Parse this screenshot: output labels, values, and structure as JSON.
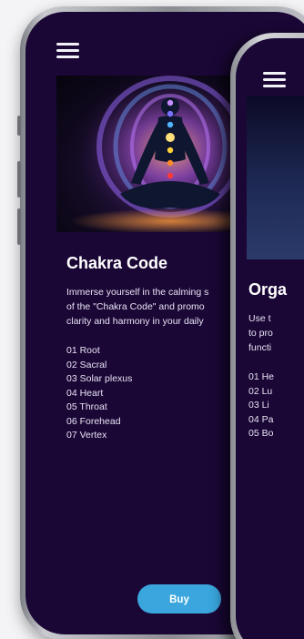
{
  "screen_left": {
    "menu_icon": "hamburger-menu-icon",
    "title": "Chakra Code",
    "description_lines": [
      "Immerse yourself in the calming s",
      "of the \"Chakra Code\" and promo",
      "clarity and harmony in your daily"
    ],
    "chakras": [
      "01 Root",
      "02 Sacral",
      "03 Solar plexus",
      "04 Heart",
      "05 Throat",
      "06 Forehead",
      "07 Vertex"
    ],
    "buy_label": "Buy",
    "accent_color": "#3aa6dd",
    "background_color": "#1a0736"
  },
  "screen_right": {
    "menu_icon": "hamburger-menu-icon",
    "title": "Orga",
    "description_lines": [
      "Use t",
      "to pro",
      "functi"
    ],
    "organs": [
      "01 He",
      "02 Lu",
      "03 Li",
      "04 Pa",
      "05 Bo"
    ]
  }
}
